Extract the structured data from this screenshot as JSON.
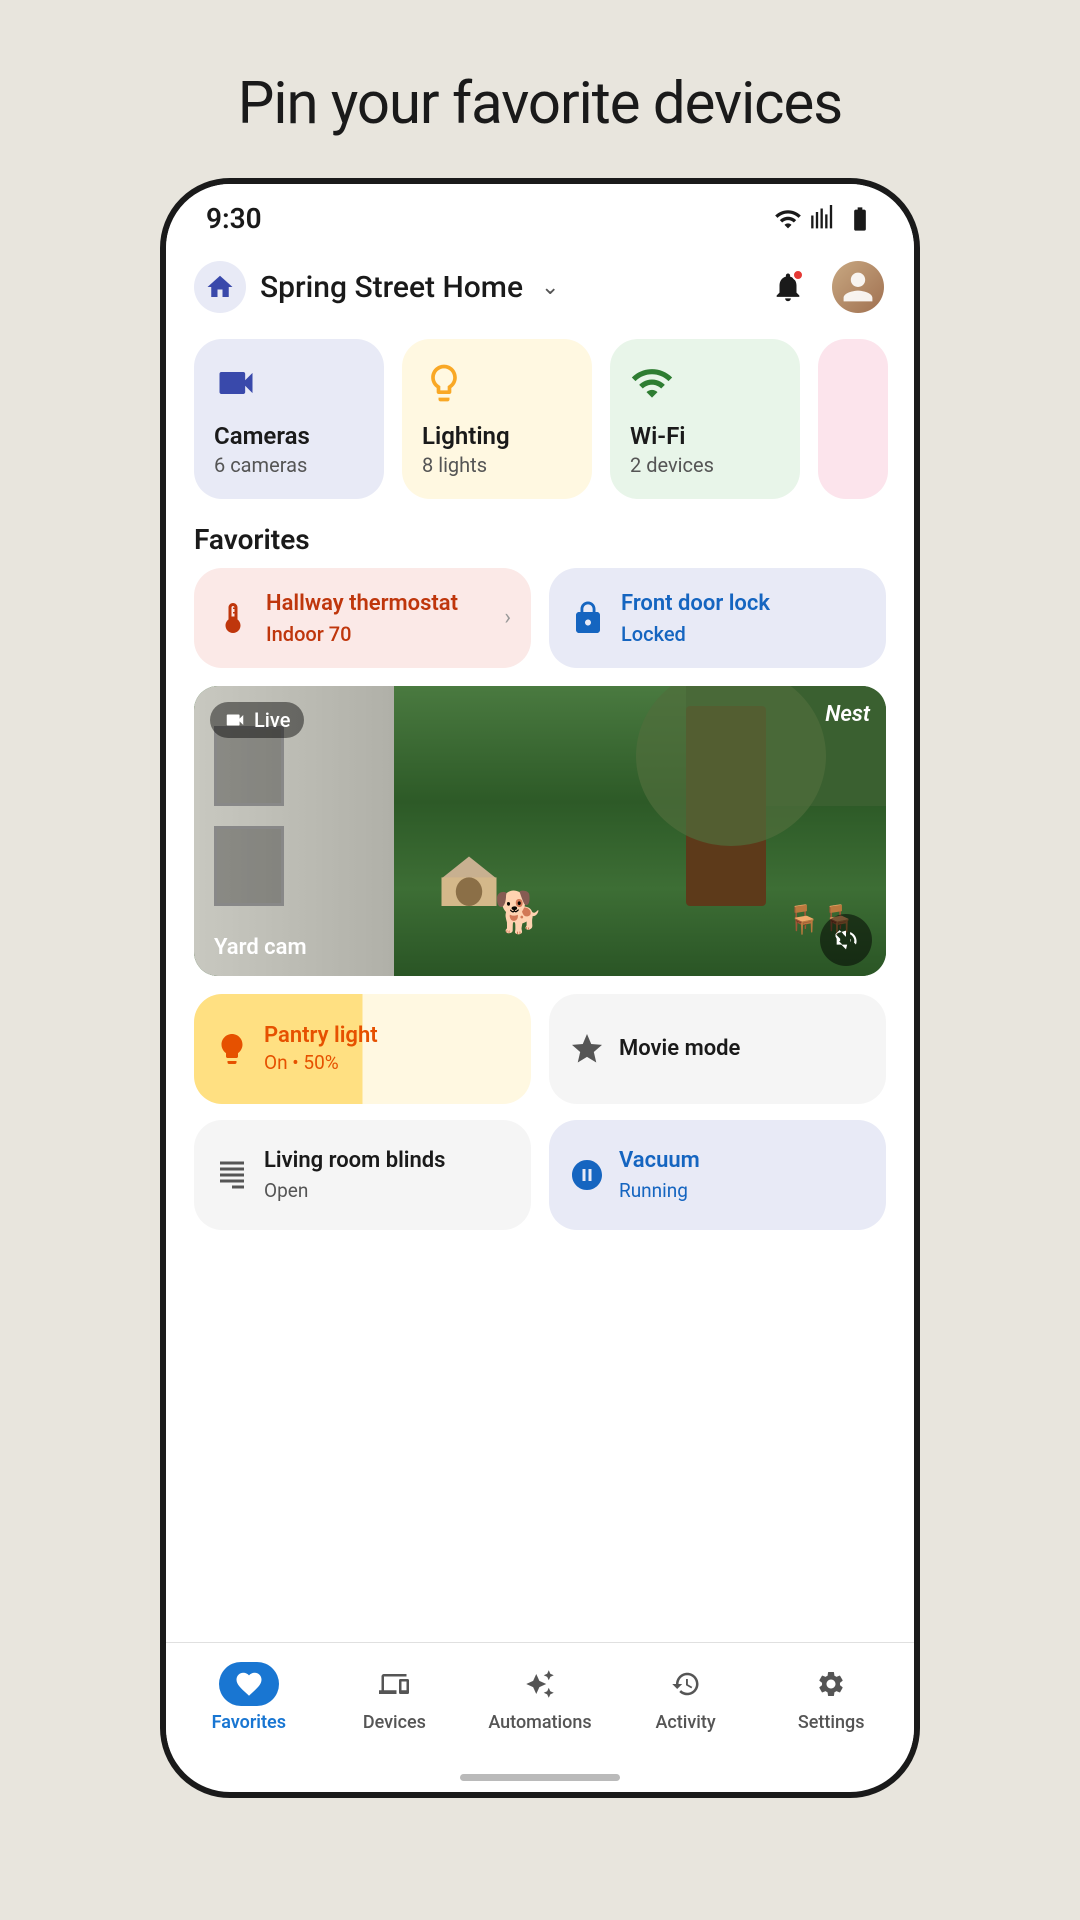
{
  "page": {
    "title": "Pin your favorite devices",
    "background_color": "#e8e5dd"
  },
  "status_bar": {
    "time": "9:30",
    "wifi_icon": "wifi-icon",
    "signal_icon": "signal-icon",
    "battery_icon": "battery-icon"
  },
  "header": {
    "home_icon": "home-icon",
    "home_name": "Spring Street Home",
    "chevron": "chevron-down-icon",
    "bell_icon": "bell-icon",
    "has_notification": true,
    "avatar_icon": "avatar-icon"
  },
  "categories": [
    {
      "id": "cameras",
      "icon": "camera-icon",
      "name": "Cameras",
      "count": "6 cameras",
      "color_class": "cameras"
    },
    {
      "id": "lighting",
      "icon": "lighting-icon",
      "name": "Lighting",
      "count": "8 lights",
      "color_class": "lighting"
    },
    {
      "id": "wifi",
      "icon": "wifi-icon",
      "name": "Wi-Fi",
      "count": "2 devices",
      "color_class": "wifi"
    }
  ],
  "favorites_section": {
    "label": "Favorites",
    "items": [
      {
        "id": "hallway-thermostat",
        "type": "thermostat",
        "name": "Hallway thermostat",
        "status": "Indoor 70",
        "icon": "thermostat-icon",
        "color_class": "thermostat"
      },
      {
        "id": "front-door-lock",
        "type": "lock",
        "name": "Front door lock",
        "status": "Locked",
        "icon": "lock-icon",
        "color_class": "lock"
      }
    ]
  },
  "camera_feed": {
    "live_label": "Live",
    "brand": "Nest",
    "camera_name": "Yard cam",
    "camera_icon": "camera-feed-icon",
    "mute_icon": "mute-icon"
  },
  "bottom_favorites": [
    {
      "id": "pantry-light",
      "name": "Pantry light",
      "status": "On • 50%",
      "icon": "bulb-icon",
      "color_class": "pantry"
    },
    {
      "id": "movie-mode",
      "name": "Movie mode",
      "status": "",
      "icon": "sparkle-icon",
      "color_class": "movie"
    }
  ],
  "lower_favorites": [
    {
      "id": "living-room-blinds",
      "name": "Living room blinds",
      "status": "Open",
      "icon": "blinds-icon",
      "color_class": "blinds"
    },
    {
      "id": "vacuum",
      "name": "Vacuum",
      "status": "Running",
      "icon": "vacuum-icon",
      "color_class": "vacuum"
    }
  ],
  "bottom_nav": {
    "items": [
      {
        "id": "favorites",
        "label": "Favorites",
        "icon": "heart-icon",
        "active": true
      },
      {
        "id": "devices",
        "label": "Devices",
        "icon": "devices-icon",
        "active": false
      },
      {
        "id": "automations",
        "label": "Automations",
        "icon": "automations-icon",
        "active": false
      },
      {
        "id": "activity",
        "label": "Activity",
        "icon": "activity-icon",
        "active": false
      },
      {
        "id": "settings",
        "label": "Settings",
        "icon": "settings-icon",
        "active": false
      }
    ]
  }
}
